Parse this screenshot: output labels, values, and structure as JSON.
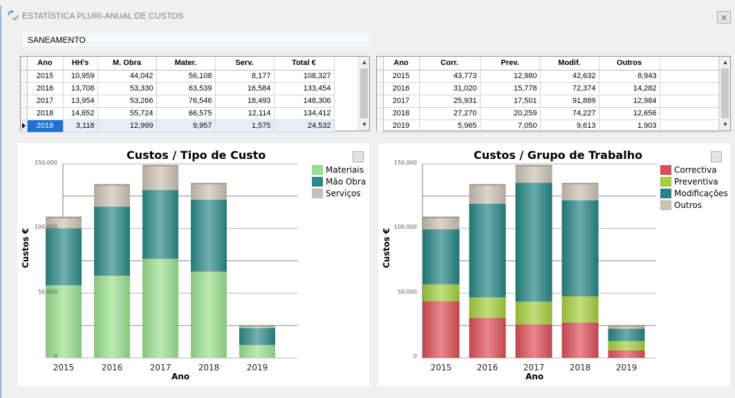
{
  "window": {
    "title": "ESTATÍSTICA PLURI-ANUAL DE CUSTOS",
    "close_glyph": "⨯"
  },
  "section": "SANEAMENTO",
  "grid_left": {
    "columns": [
      "Ano",
      "HH's",
      "M. Obra",
      "Mater.",
      "Serv.",
      "Total €"
    ],
    "rows": [
      [
        "2015",
        "10,959",
        "44,042",
        "56,108",
        "8,177",
        "108,327"
      ],
      [
        "2016",
        "13,708",
        "53,330",
        "63,539",
        "16,584",
        "133,454"
      ],
      [
        "2017",
        "13,954",
        "53,266",
        "76,546",
        "18,493",
        "148,306"
      ],
      [
        "2018",
        "14,652",
        "55,724",
        "66,575",
        "12,114",
        "134,412"
      ],
      [
        "2019",
        "3,118",
        "12,999",
        "9,957",
        "1,575",
        "24,532"
      ]
    ]
  },
  "grid_right": {
    "columns": [
      "Ano",
      "Corr.",
      "Prev.",
      "Modif.",
      "Outros"
    ],
    "rows": [
      [
        "2015",
        "43,773",
        "12,980",
        "42,632",
        "8,943"
      ],
      [
        "2016",
        "31,020",
        "15,778",
        "72,374",
        "14,282"
      ],
      [
        "2017",
        "25,931",
        "17,501",
        "91,889",
        "12,984"
      ],
      [
        "2018",
        "27,270",
        "20,259",
        "74,227",
        "12,656"
      ],
      [
        "2019",
        "5,965",
        "7,050",
        "9,613",
        "1,903"
      ]
    ]
  },
  "chart_data": [
    {
      "type": "bar",
      "stacked": true,
      "title": "Custos / Tipo de Custo",
      "xlabel": "Ano",
      "ylabel": "Custos €",
      "categories": [
        "2015",
        "2016",
        "2017",
        "2018",
        "2019"
      ],
      "ylim": [
        0,
        150000
      ],
      "yticks": [
        "0",
        "50,000",
        "100,000",
        "150,000"
      ],
      "grid": true,
      "legend": "top-right",
      "series": [
        {
          "name": "Materiais",
          "color": "#9be08f",
          "values": [
            56108,
            63539,
            76546,
            66575,
            9957
          ]
        },
        {
          "name": "Mão Obra",
          "color": "#2e8a8a",
          "values": [
            44042,
            53330,
            53266,
            55724,
            12999
          ]
        },
        {
          "name": "Serviços",
          "color": "#cbc1b3",
          "values": [
            8177,
            16584,
            18493,
            12114,
            1575
          ]
        }
      ]
    },
    {
      "type": "bar",
      "stacked": true,
      "title": "Custos / Grupo de Trabalho",
      "xlabel": "Ano",
      "ylabel": "Custos €",
      "categories": [
        "2015",
        "2016",
        "2017",
        "2018",
        "2019"
      ],
      "ylim": [
        0,
        150000
      ],
      "yticks": [
        "0",
        "50,000",
        "100,000",
        "150,000"
      ],
      "grid": true,
      "legend": "top-right",
      "series": [
        {
          "name": "Correctiva",
          "color": "#db4f59",
          "values": [
            43773,
            31020,
            25931,
            27270,
            5965
          ]
        },
        {
          "name": "Preventiva",
          "color": "#a6cf3d",
          "values": [
            12980,
            15778,
            17501,
            20259,
            7050
          ]
        },
        {
          "name": "Modificações",
          "color": "#258585",
          "values": [
            42632,
            72374,
            91889,
            74227,
            9613
          ]
        },
        {
          "name": "Outros",
          "color": "#cbc1b3",
          "values": [
            8943,
            14282,
            12984,
            12656,
            1903
          ]
        }
      ]
    }
  ]
}
